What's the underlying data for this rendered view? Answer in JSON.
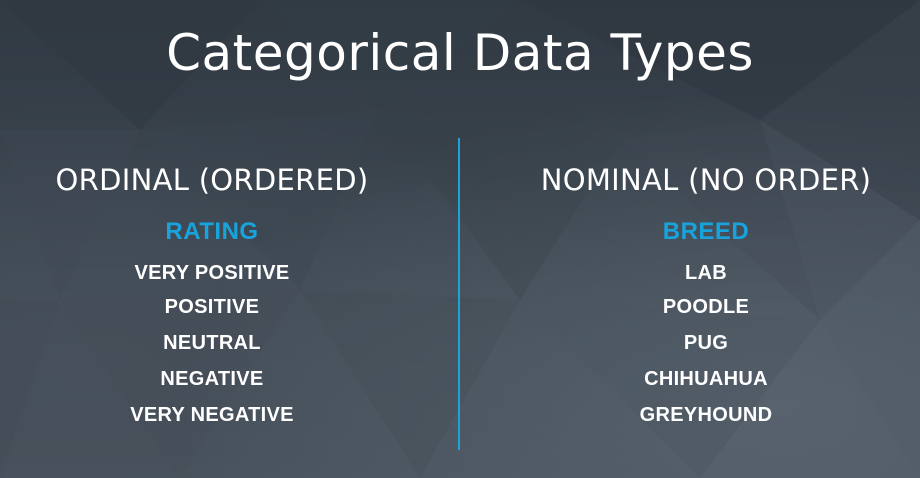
{
  "slide": {
    "title": "Categorical Data Types",
    "ordinal": {
      "heading": "ORDINAL (ORDERED)",
      "example_label": "RATING",
      "items": [
        "VERY POSITIVE",
        "POSITIVE",
        "NEUTRAL",
        "NEGATIVE",
        "VERY NEGATIVE"
      ]
    },
    "nominal": {
      "heading": "NOMINAL (NO ORDER)",
      "example_label": "BREED",
      "items": [
        "LAB",
        "POODLE",
        "PUG",
        "CHIHUAHUA",
        "GREYHOUND"
      ]
    }
  },
  "colors": {
    "background": "#3a434d",
    "accent": "#17a4dd",
    "text": "#ffffff"
  }
}
